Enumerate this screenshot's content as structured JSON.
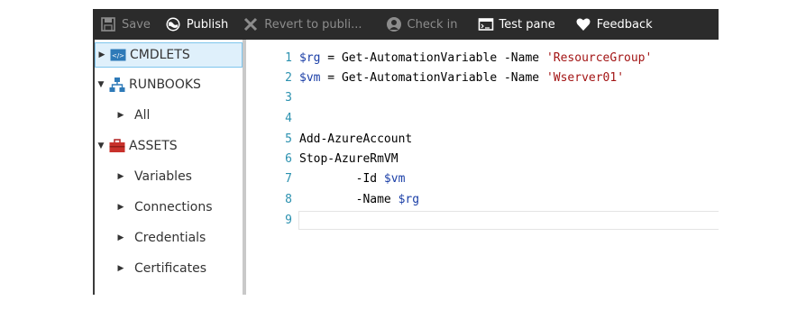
{
  "toolbar": {
    "save": "Save",
    "publish": "Publish",
    "revert": "Revert to publi...",
    "checkin": "Check in",
    "testpane": "Test pane",
    "feedback": "Feedback"
  },
  "sidebar": {
    "cmdlets": "CMDLETS",
    "runbooks": "RUNBOOKS",
    "all": "All",
    "assets": "ASSETS",
    "variables": "Variables",
    "connections": "Connections",
    "credentials": "Credentials",
    "certificates": "Certificates"
  },
  "editor": {
    "line_numbers": [
      "1",
      "2",
      "3",
      "4",
      "5",
      "6",
      "7",
      "8",
      "9"
    ],
    "l1_var": "$rg",
    "l1_mid": " = Get-AutomationVariable -Name ",
    "l1_str": "'ResourceGroup'",
    "l2_var": "$vm",
    "l2_mid": " = Get-AutomationVariable -Name ",
    "l2_str": "'Wserver01'",
    "l5": "Add-AzureAccount",
    "l6": "Stop-AzureRmVM",
    "l7_a": "        -Id ",
    "l7_var": "$vm",
    "l8_a": "        -Name ",
    "l8_var": "$rg"
  },
  "icons": {
    "save": "floppy-disk-icon",
    "publish": "globe-icon",
    "revert": "x-icon",
    "checkin": "person-icon",
    "testpane": "console-window-icon",
    "feedback": "heart-icon",
    "cmdlets": "code-icon",
    "runbooks": "hierarchy-icon",
    "assets": "briefcase-icon"
  },
  "colors": {
    "toolbar_bg": "#2b2b2b",
    "selection_bg": "#dff0fb",
    "line_number": "#2b91af",
    "variable": "#1b3fa7",
    "string": "#a31515"
  }
}
